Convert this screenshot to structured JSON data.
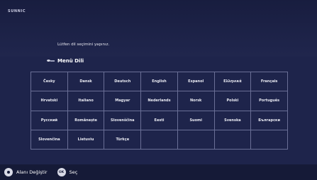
{
  "brand": "SUNNIC",
  "prompt": "Lütfen dil seçimini yapınız.",
  "menu": {
    "title": "Menü Dili",
    "icon": "menu-arrow-icon"
  },
  "languages": [
    [
      "Česky",
      "Dansk",
      "Deutsch",
      "English",
      "Espanol",
      "Ελληνικά",
      "Français"
    ],
    [
      "Hrvatski",
      "Italiano",
      "Magyar",
      "Nederlands",
      "Norsk",
      "Polski",
      "Português"
    ],
    [
      "Русский",
      "Românește",
      "Slovenščina",
      "Eesti",
      "Suomi",
      "Svenska",
      "Български"
    ],
    [
      "Slovenčina",
      "Lietuviu",
      "Türkçe",
      "",
      "",
      "",
      ""
    ]
  ],
  "footer": {
    "move_label": "Alanı Değiştir",
    "move_icon": "dpad-icon",
    "ok_icon_text": "OK",
    "select_label": "Seç"
  }
}
